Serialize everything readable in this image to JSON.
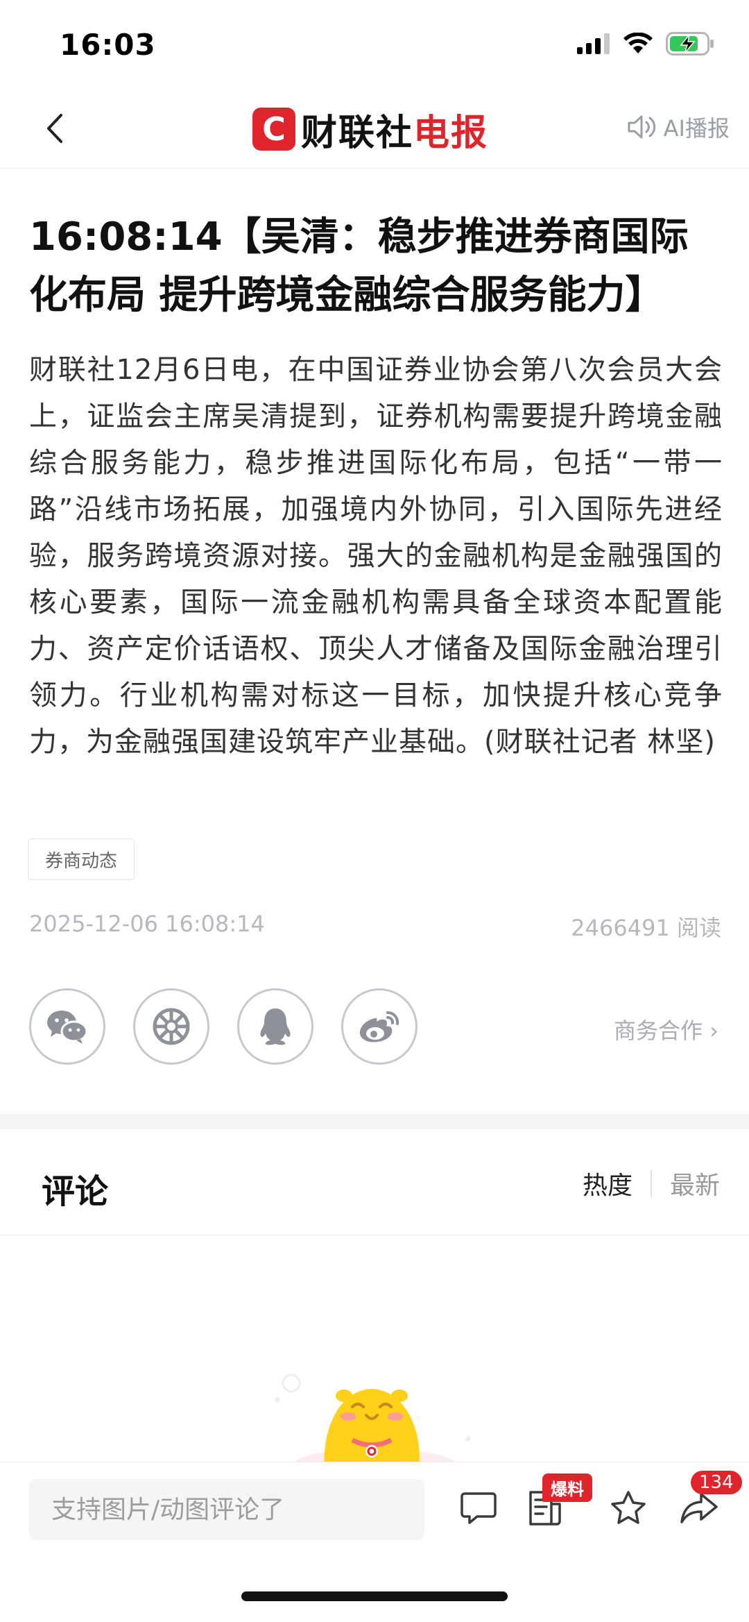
{
  "status_bar": {
    "time": "16:03"
  },
  "nav": {
    "brand_logo_letter": "C",
    "brand_black": "财联社",
    "brand_red": "电报",
    "ai_play_label": "AI播报"
  },
  "article": {
    "headline": "16:08:14【吴清：稳步推进券商国际化布局 提升跨境金融综合服务能力】",
    "body": "财联社12月6日电，在中国证券业协会第八次会员大会上，证监会主席吴清提到，证券机构需要提升跨境金融综合服务能力，稳步推进国际化布局，包括“一带一路”沿线市场拓展，加强境内外协同，引入国际先进经验，服务跨境资源对接。强大的金融机构是金融强国的核心要素，国际一流金融机构需具备全球资本配置能力、资产定价话语权、顶尖人才储备及国际金融治理引领力。行业机构需对标这一目标，加快提升核心竞争力，为金融强国建设筑牢产业基础。(财联社记者 林坚)",
    "tag": "券商动态",
    "date": "2025-12-06 16:08:14",
    "reads": "2466491 阅读"
  },
  "share": {
    "business_link": "商务合作 ›",
    "icons": [
      "wechat-icon",
      "moments-icon",
      "qq-icon",
      "weibo-icon"
    ]
  },
  "comments": {
    "title": "评论",
    "sort_hot": "热度",
    "sort_new": "最新"
  },
  "bottom_bar": {
    "input_placeholder": "支持图片/动图评论了",
    "tip_badge": "爆料",
    "share_count": "134"
  },
  "colors": {
    "brand_red": "#e0242b",
    "icon_gray": "#8e9199"
  }
}
